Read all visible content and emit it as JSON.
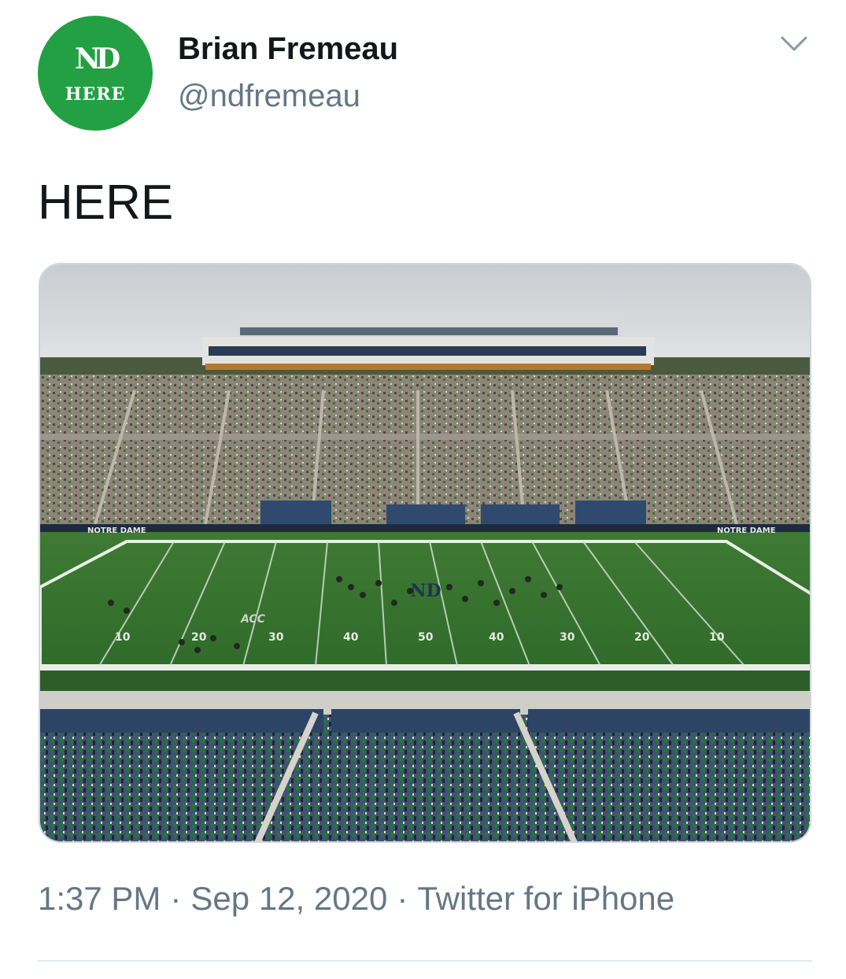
{
  "tweet": {
    "author": {
      "name": "Brian Fremeau",
      "handle": "@ndfremeau",
      "avatar": {
        "monogram": "ND",
        "text": "HERE",
        "color": "#23a043"
      }
    },
    "text": "HERE",
    "media": {
      "field_numbers": [
        "10",
        "20",
        "30",
        "40",
        "50",
        "40",
        "30",
        "20",
        "10"
      ],
      "wall_text_left": "NOTRE DAME",
      "wall_text_right": "NOTRE DAME",
      "midfield_logo": "ND",
      "conference_logo": "ACC"
    },
    "time": "1:37 PM",
    "date": "Sep 12, 2020",
    "source": "Twitter for iPhone",
    "separator": "·"
  },
  "icons": {
    "more": "chevron-down-icon"
  },
  "colors": {
    "accent_green": "#23a043",
    "secondary_text": "#657786",
    "divider": "#e1e8ed"
  }
}
